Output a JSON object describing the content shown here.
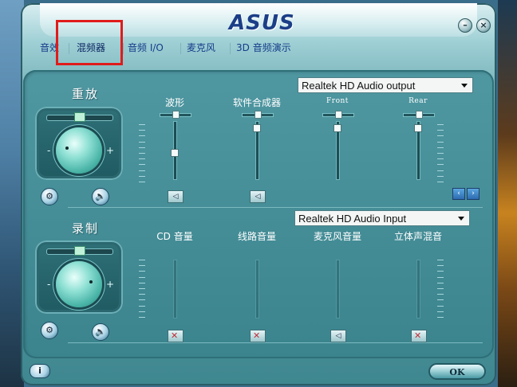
{
  "window": {
    "logo": "ASUS",
    "minimize_label": "–",
    "close_label": "×"
  },
  "tabs": [
    {
      "label": "音效"
    },
    {
      "label": "混频器"
    },
    {
      "label": "音频 I/O"
    },
    {
      "label": "麦克风"
    },
    {
      "label": "3D 音频演示"
    }
  ],
  "playback": {
    "title": "重放",
    "device": "Realtek HD Audio output",
    "channels": [
      {
        "label": "波形",
        "level": 0.45
      },
      {
        "label": "软件合成器",
        "level": 0.88
      },
      {
        "label": "Front",
        "level": 0.88
      },
      {
        "label": "Rear",
        "level": 0.88
      }
    ]
  },
  "record": {
    "title": "录制",
    "device": "Realtek HD Audio Input",
    "channels": [
      {
        "label": "CD 音量",
        "muted": true
      },
      {
        "label": "线路音量",
        "muted": true
      },
      {
        "label": "麦克风音量",
        "muted": false
      },
      {
        "label": "立体声混音",
        "muted": true
      }
    ]
  },
  "footer": {
    "info_label": "i",
    "ok_label": "OK"
  },
  "colors": {
    "highlight_box": "#e01b1b",
    "tab_text": "#163c8a",
    "panel": "#3f8790"
  }
}
